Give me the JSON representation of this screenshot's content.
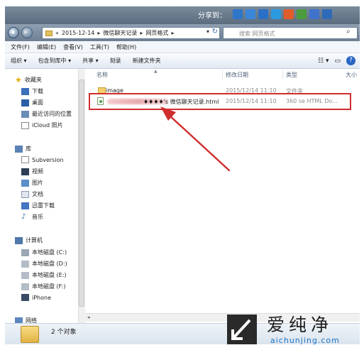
{
  "titlebar": {
    "share_label": "分享到：",
    "share_icon_names": [
      "qq-share-icon",
      "weibo-share-icon",
      "renren-share-icon",
      "tencent-share-icon",
      "kaixin-share-icon",
      "douban-share-icon",
      "baidu-share-icon",
      "more-share-icon"
    ],
    "share_colors": [
      "#2d76c9",
      "#3a86d8",
      "#2c6fc6",
      "#2b9ae0",
      "#e25b2a",
      "#4a9c3c",
      "#3f72cc",
      "#2f6ab8"
    ]
  },
  "address": {
    "prefix": "«",
    "crumbs": [
      "2015-12-14",
      "微信聊天记录",
      "网页格式"
    ],
    "separator": "▸",
    "dropdown": "▾",
    "refresh": "↻",
    "search_placeholder": "搜索 网页格式"
  },
  "menu": [
    "文件(F)",
    "编辑(E)",
    "查看(V)",
    "工具(T)",
    "帮助(H)"
  ],
  "commands": [
    "组织 ▾",
    "包含到库中 ▾",
    "共享 ▾",
    "刻录",
    "新建文件夹"
  ],
  "view_controls": {
    "views": "☷ ▾",
    "preview": "▭",
    "help": "?"
  },
  "nav": {
    "favorites": {
      "header": "收藏夹",
      "items": [
        "下载",
        "桌面",
        "最近访问的位置",
        "iCloud 照片"
      ]
    },
    "libraries": {
      "header": "库",
      "items": [
        "Subversion",
        "视频",
        "图片",
        "文档",
        "迅雷下载",
        "音乐"
      ]
    },
    "computer": {
      "header": "计算机",
      "items": [
        "本地磁盘 (C:)",
        "本地磁盘 (D:)",
        "本地磁盘 (E:)",
        "本地磁盘 (F:)",
        "iPhone"
      ]
    },
    "network": {
      "header": "网络"
    }
  },
  "columns": {
    "name": "名称",
    "date": "修改日期",
    "type": "类型",
    "size": "大小"
  },
  "files": [
    {
      "name": "image",
      "date": "2015/12/14 11:10",
      "type": "文件夹"
    },
    {
      "name": "♦♦♦♦'s 微信聊天记录.html",
      "date": "2015/12/14 11:10",
      "type": "360 se HTML Do..."
    }
  ],
  "status": {
    "count": "2 个对象"
  },
  "watermark": {
    "title": "爱纯净",
    "url": "aichunjing.com"
  },
  "annotation_color": "#d02d2d"
}
